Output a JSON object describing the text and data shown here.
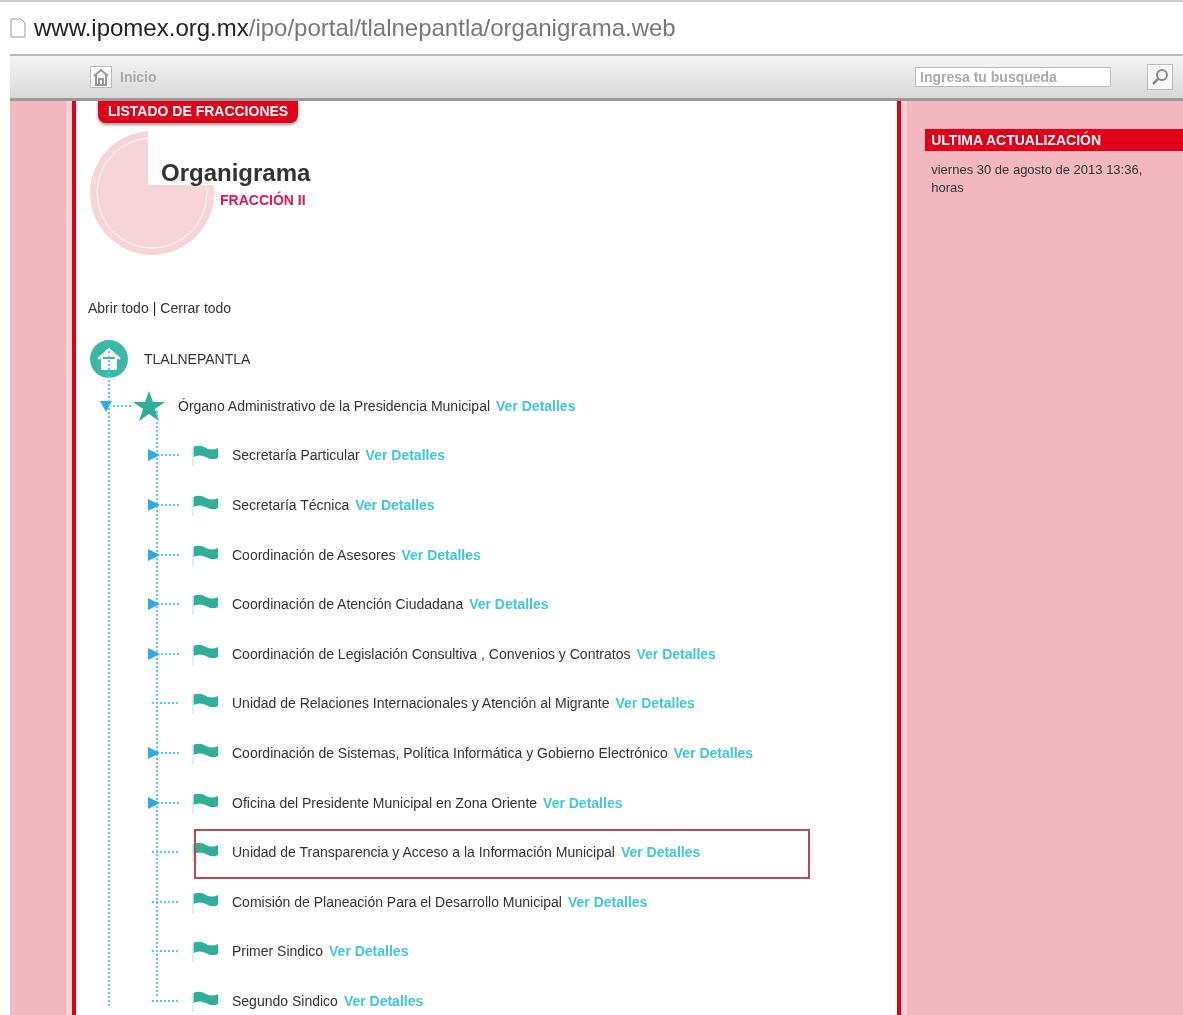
{
  "address_bar": {
    "host": "www.ipomex.org.mx",
    "path": "/ipo/portal/tlalnepantla/organigrama.web"
  },
  "toolbar": {
    "home_label": "Inicio",
    "search": {
      "placeholder": "Ingresa tu busqueda"
    }
  },
  "tab_label": "LISTADO DE FRACCIONES",
  "heading": {
    "title": "Organigrama",
    "subtitle": "FRACCIÓN II"
  },
  "tree_controls": {
    "open_all": "Abrir todo",
    "separator": "|",
    "close_all": "Cerrar todo"
  },
  "tree": {
    "root": "TLALNEPANTLA",
    "items": [
      {
        "label": "Órgano Administrativo de la Presidencia Municipal",
        "link": "Ver Detalles",
        "expanded": true,
        "children": [
          {
            "label": "Secretaría Particular",
            "link": "Ver Detalles",
            "expandable": true,
            "highlighted": false
          },
          {
            "label": "Secretaría Técnica",
            "link": "Ver Detalles",
            "expandable": true,
            "highlighted": false
          },
          {
            "label": "Coordinación de Asesores",
            "link": "Ver Detalles",
            "expandable": true,
            "highlighted": false
          },
          {
            "label": "Coordinación de Atención Ciudadana",
            "link": "Ver Detalles",
            "expandable": true,
            "highlighted": false
          },
          {
            "label": "Coordinación de Legislación Consultiva , Convenios y Contratos",
            "link": "Ver Detalles",
            "expandable": true,
            "highlighted": false
          },
          {
            "label": "Unidad de Relaciones Internacionales y Atención al Migrante",
            "link": "Ver Detalles",
            "expandable": false,
            "highlighted": false
          },
          {
            "label": "Coordinación de Sistemas, Política Informática y Gobierno Electrónico",
            "link": "Ver Detalles",
            "expandable": true,
            "highlighted": false
          },
          {
            "label": "Oficina del Presidente Municipal en Zona Oriente",
            "link": "Ver Detalles",
            "expandable": true,
            "highlighted": false
          },
          {
            "label": "Unidad de Transparencia y Acceso a la Información Municipal",
            "link": "Ver Detalles",
            "expandable": false,
            "highlighted": true
          },
          {
            "label": "Comisión de Planeación Para el Desarrollo Municipal",
            "link": "Ver Detalles",
            "expandable": false,
            "highlighted": false
          },
          {
            "label": "Primer Sindico",
            "link": "Ver Detalles",
            "expandable": false,
            "highlighted": false
          },
          {
            "label": "Segundo Sindico",
            "link": "Ver Detalles",
            "expandable": false,
            "highlighted": false
          }
        ]
      }
    ]
  },
  "sidebar": {
    "title": "ULTIMA ACTUALIZACIÓN",
    "text": "viernes 30 de agosto de 2013 13:36, horas"
  }
}
